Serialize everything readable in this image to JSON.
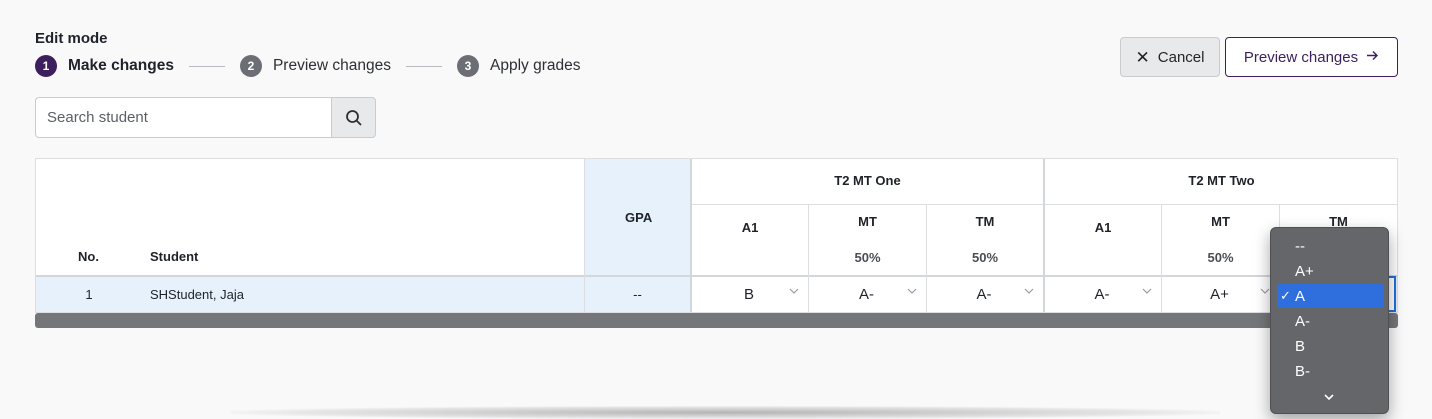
{
  "header": {
    "title": "Edit mode",
    "steps": [
      {
        "num": "1",
        "label": "Make changes"
      },
      {
        "num": "2",
        "label": "Preview changes"
      },
      {
        "num": "3",
        "label": "Apply grades"
      }
    ],
    "cancel_label": "Cancel",
    "preview_label": "Preview changes"
  },
  "search": {
    "placeholder": "Search student",
    "value": ""
  },
  "table": {
    "col_no": "No.",
    "col_student": "Student",
    "col_gpa": "GPA",
    "groups": [
      {
        "name": "T2 MT One",
        "cols": [
          {
            "name": "A1",
            "weight": ""
          },
          {
            "name": "MT",
            "weight": "50%"
          },
          {
            "name": "TM",
            "weight": "50%"
          }
        ]
      },
      {
        "name": "T2 MT Two",
        "cols": [
          {
            "name": "A1",
            "weight": ""
          },
          {
            "name": "MT",
            "weight": "50%"
          },
          {
            "name": "TM",
            "weight": ""
          }
        ]
      }
    ],
    "rows": [
      {
        "no": "1",
        "student": "SHStudent, Jaja",
        "gpa": "--",
        "grades": [
          "B",
          "A-",
          "A-",
          "A-",
          "A+",
          "A"
        ]
      }
    ]
  },
  "dropdown": {
    "options": [
      "--",
      "A+",
      "A",
      "A-",
      "B",
      "B-"
    ],
    "selected": "A",
    "check": "✓"
  },
  "colors": {
    "brand": "#3c1f5c",
    "highlight": "#e7f1fb",
    "selected_option": "#2f6fdd"
  }
}
